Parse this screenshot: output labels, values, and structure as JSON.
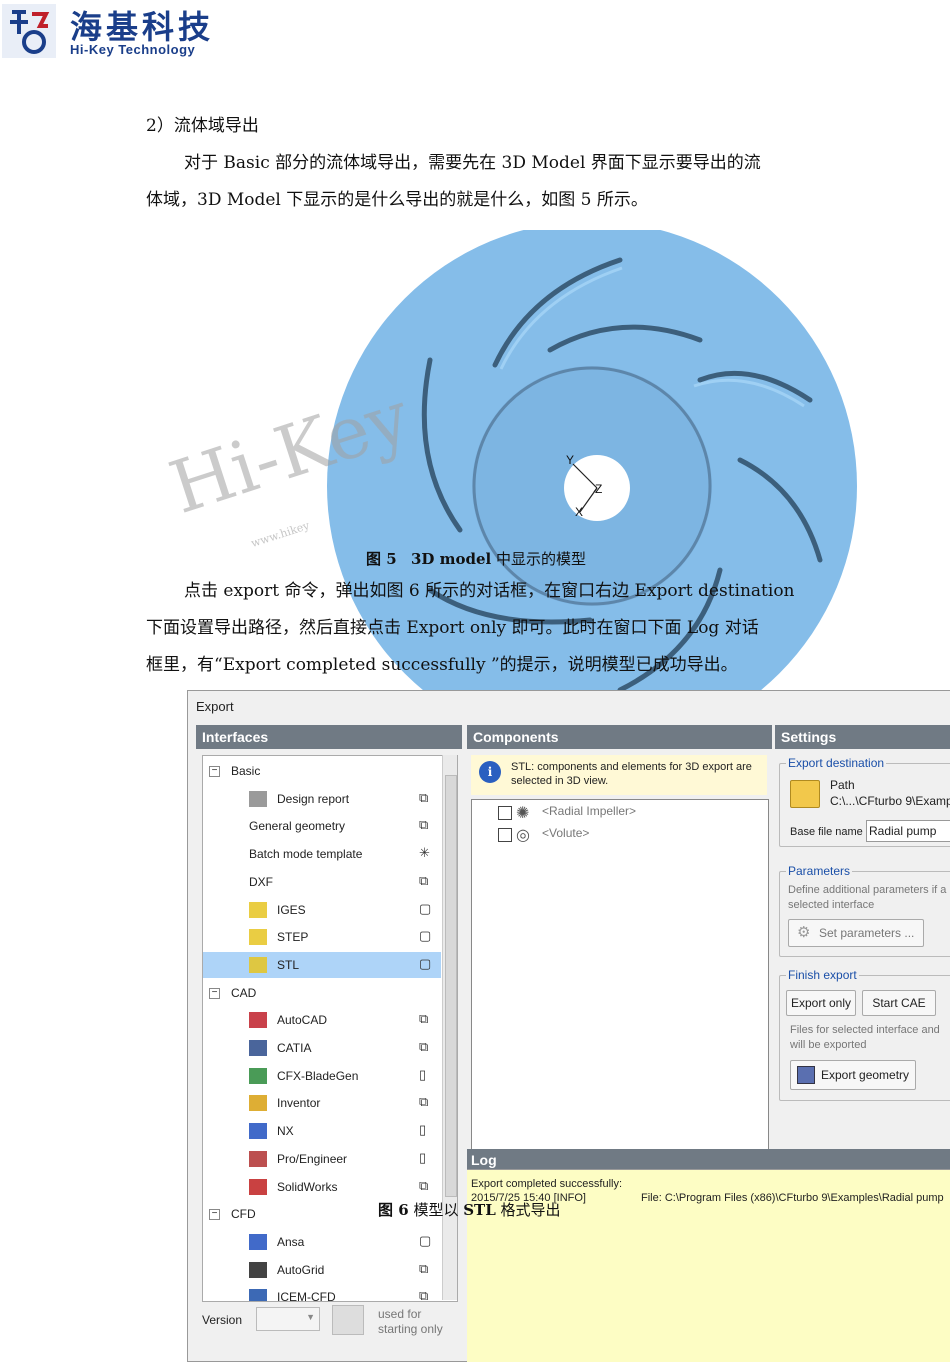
{
  "logo": {
    "cn": "海基科技",
    "en": "Hi-Key Technology"
  },
  "doc": {
    "heading": "2）流体域导出",
    "para1_l1": "对于 Basic 部分的流体域导出，需要先在 3D  Model 界面下显示要导出的流",
    "para1_l2": "体域，3D Model 下显示的是什么导出的就是什么，如图 5 所示。",
    "fig5_num": "图 5",
    "fig5_bold": "3D model",
    "fig5_rest": " 中显示的模型",
    "para2_l1": "点击 export 命令，弹出如图 6 所示的对话框，在窗口右边 Export destination",
    "para2_l2": "下面设置导出路径，然后直接点击 Export  only 即可。此时在窗口下面 Log 对话",
    "para2_l3": "框里，有“Export completed successfully ”的提示，说明模型已成功导出。",
    "fig6_num": "图 6",
    "fig6_mid": " 模型以 ",
    "fig6_bold": "STL",
    "fig6_rest": " 格式导出"
  },
  "watermark": {
    "text": "Hi-Key",
    "url": "www.hikey"
  },
  "axes": {
    "y": "Y",
    "z": "Z",
    "x": "X"
  },
  "dialog": {
    "title": "Export",
    "interfaces_title": "Interfaces",
    "components_title": "Components",
    "settings_title": "Settings",
    "tree": [
      {
        "label": "Basic",
        "type": "group"
      },
      {
        "label": "Design report",
        "type": "item",
        "icon": "report-icon",
        "action": "copy-icon"
      },
      {
        "label": "General geometry",
        "type": "item",
        "icon": "",
        "action": "copy-icon"
      },
      {
        "label": "Batch mode template",
        "type": "item",
        "icon": "",
        "action": "asterisk-icon"
      },
      {
        "label": "DXF",
        "type": "item",
        "icon": "",
        "action": "copy-icon"
      },
      {
        "label": "IGES",
        "type": "item",
        "icon": "cube-icon",
        "action": "box-icon"
      },
      {
        "label": "STEP",
        "type": "item",
        "icon": "cube-icon",
        "action": "box-icon"
      },
      {
        "label": "STL",
        "type": "item",
        "icon": "cube-icon",
        "action": "box-icon",
        "selected": true
      },
      {
        "label": "CAD",
        "type": "group"
      },
      {
        "label": "AutoCAD",
        "type": "item",
        "icon": "autocad-icon",
        "action": "copy-icon"
      },
      {
        "label": "CATIA",
        "type": "item",
        "icon": "catia-icon",
        "action": "copy-icon"
      },
      {
        "label": "CFX-BladeGen",
        "type": "item",
        "icon": "bladegen-icon",
        "action": "square-icon"
      },
      {
        "label": "Inventor",
        "type": "item",
        "icon": "inventor-icon",
        "action": "copy-icon"
      },
      {
        "label": "NX",
        "type": "item",
        "icon": "nx-icon",
        "action": "square-icon"
      },
      {
        "label": "Pro/Engineer",
        "type": "item",
        "icon": "proe-icon",
        "action": "square-icon"
      },
      {
        "label": "SolidWorks",
        "type": "item",
        "icon": "solidworks-icon",
        "action": "copy-icon"
      },
      {
        "label": "CFD",
        "type": "group"
      },
      {
        "label": "Ansa",
        "type": "item",
        "icon": "ansa-icon",
        "action": "box-icon"
      },
      {
        "label": "AutoGrid",
        "type": "item",
        "icon": "autogrid-icon",
        "action": "copy-icon"
      },
      {
        "label": "ICEM-CFD",
        "type": "item",
        "icon": "icem-icon",
        "action": "copy-icon"
      }
    ],
    "version_label": "Version",
    "used_for": "used for",
    "starting_only": "starting only",
    "info_text_l1": "STL: components and elements for 3D export are",
    "info_text_l2": "selected in 3D view.",
    "components": [
      {
        "label": "<Radial Impeller>",
        "icon": "impeller-icon"
      },
      {
        "label": "<Volute>",
        "icon": "volute-icon"
      }
    ],
    "export_destination": "Export destination",
    "path_label": "Path",
    "path_value": "C:\\...\\CFturbo 9\\Examp",
    "base_file_label": "Base file name",
    "base_file_value": "Radial pump",
    "parameters_title": "Parameters",
    "parameters_desc_l1": "Define additional parameters if a",
    "parameters_desc_l2": "selected interface",
    "set_parameters": "Set parameters ...",
    "finish_title": "Finish export",
    "export_only": "Export only",
    "start_cae": "Start CAE",
    "finish_desc_l1": "Files for selected interface and",
    "finish_desc_l2": "will be exported",
    "export_geometry": "Export geometry",
    "log_title": "Log",
    "log_l1": "Export completed successfully:",
    "log_l2_time": "2015/7/25 15:40 [INFO]",
    "log_l2_file": "File: C:\\Program Files (x86)\\CFturbo 9\\Examples\\Radial pump"
  }
}
